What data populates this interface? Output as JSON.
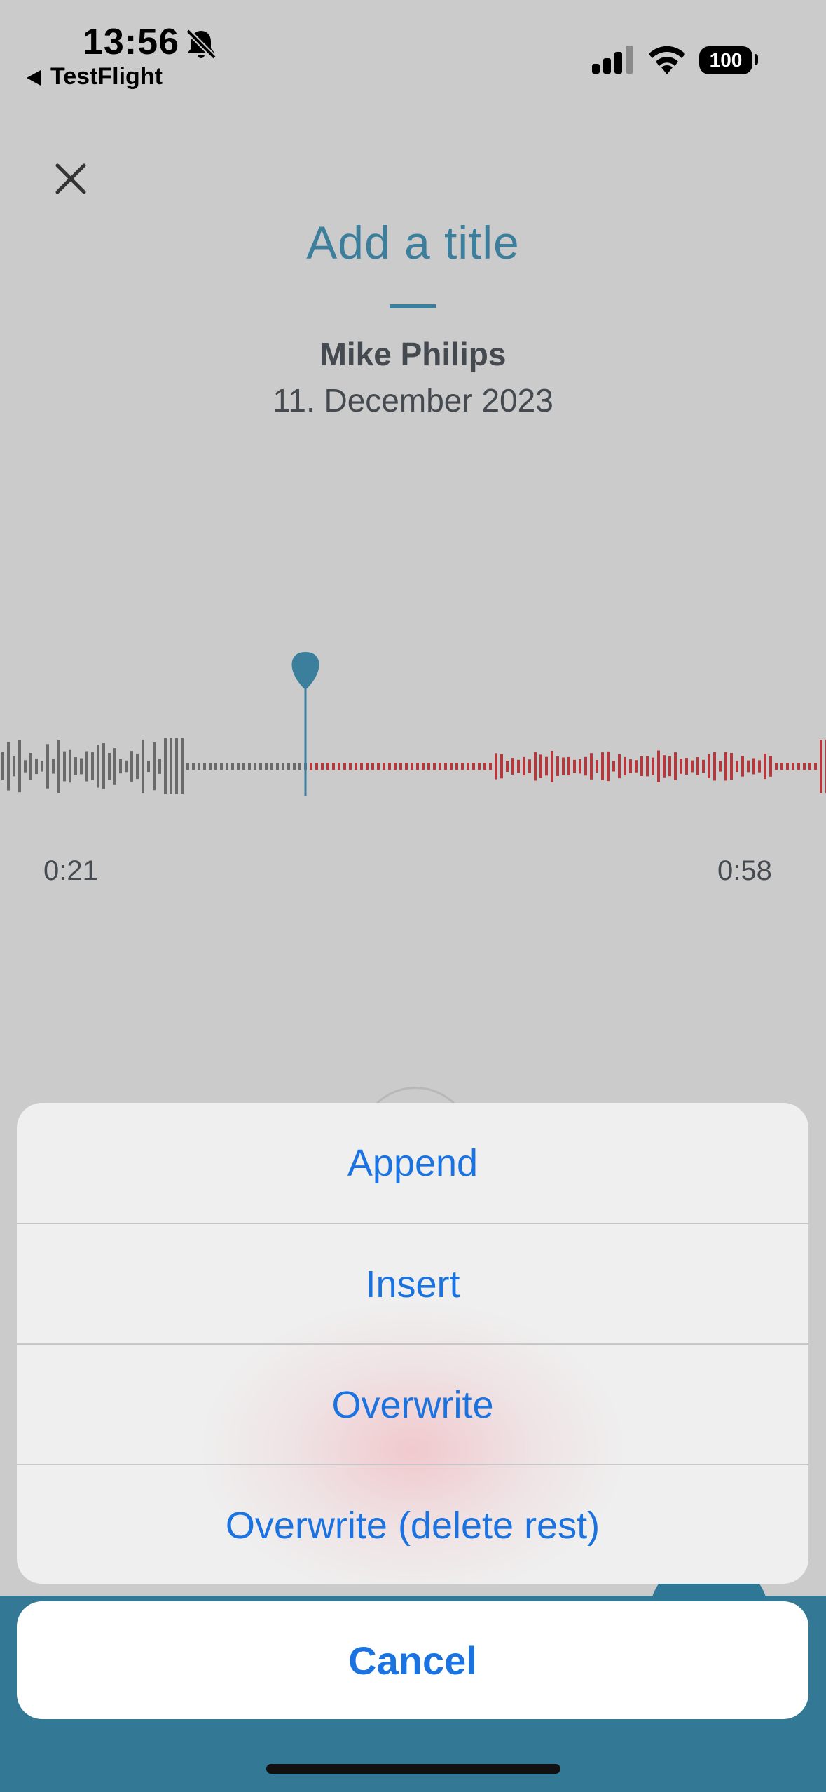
{
  "status_bar": {
    "time": "13:56",
    "back_app": "TestFlight",
    "battery": "100",
    "icons": [
      "bell-slash-icon",
      "back-arrow-icon",
      "signal-icon",
      "wifi-icon",
      "battery-icon"
    ]
  },
  "header": {
    "title": "Add a title",
    "author": "Mike Philips",
    "date": "11. December 2023",
    "close_icon": "close-icon"
  },
  "player": {
    "time_start": "0:21",
    "time_end": "0:58",
    "playhead_position": 0.37
  },
  "action_sheet": {
    "items": [
      {
        "label": "Append"
      },
      {
        "label": "Insert"
      },
      {
        "label": "Overwrite"
      },
      {
        "label": "Overwrite (delete rest)"
      }
    ],
    "cancel": "Cancel"
  },
  "colors": {
    "accent": "#3b7f9c",
    "waveform_played": "#6a6a6a",
    "waveform_overwrite": "#b23a3e",
    "action_blue": "#1a73e0",
    "bottom_bar": "#337995"
  }
}
